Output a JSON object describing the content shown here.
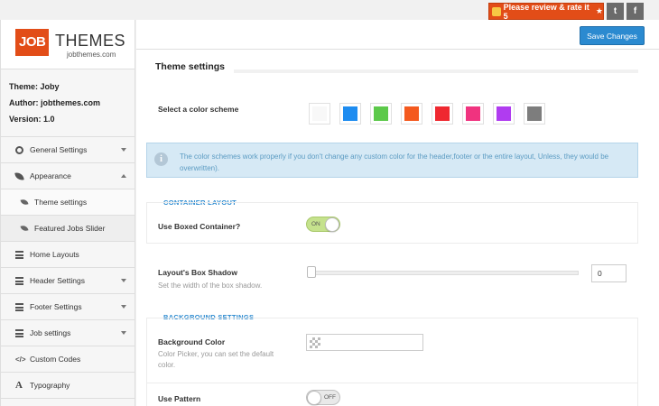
{
  "topbar": {
    "review_label": "Please review & rate it 5",
    "star_glyph": "★",
    "twitter_glyph": "t",
    "facebook_glyph": "f"
  },
  "logo": {
    "job": "JOB",
    "themes": "THEMES",
    "domain": "jobthemes.com"
  },
  "theme_info": {
    "theme": "Theme: Joby",
    "author": "Author: jobthemes.com",
    "version": "Version: 1.0"
  },
  "sidebar": {
    "items": [
      {
        "label": "General Settings",
        "icon": "gear-icon"
      },
      {
        "label": "Appearance",
        "icon": "leaf-icon"
      },
      {
        "label": "Theme settings",
        "icon": "leaf-icon"
      },
      {
        "label": "Featured Jobs Slider",
        "icon": "leaf-icon"
      },
      {
        "label": "Home Layouts",
        "icon": "list-icon"
      },
      {
        "label": "Header Settings",
        "icon": "list-icon"
      },
      {
        "label": "Footer Settings",
        "icon": "list-icon"
      },
      {
        "label": "Job settings",
        "icon": "list-icon"
      },
      {
        "label": "Custom Codes",
        "icon": "code-icon"
      },
      {
        "label": "Typography",
        "icon": "typography-icon"
      }
    ]
  },
  "header": {
    "save_label": "Save Changes"
  },
  "main": {
    "section_title": "Theme settings",
    "color_scheme_label": "Select a color scheme",
    "swatches": [
      "#f8f8f8",
      "#1e8cf0",
      "#5cc94a",
      "#f4591e",
      "#ef2830",
      "#f0337f",
      "#b03cf0",
      "#7d7d7d"
    ],
    "info_icon": "i",
    "info_text": "The color schemes work properly if you don't change any custom color for the header,footer or the entire layout, Unless, they would be overwritten).",
    "container_layout": {
      "title": "CONTAINER LAYOUT",
      "boxed_label": "Use Boxed Container?",
      "boxed_toggle": "ON"
    },
    "box_shadow": {
      "label": "Layout's Box Shadow",
      "desc": "Set the width of the box shadow.",
      "value": "0",
      "level": 0
    },
    "background_settings": {
      "title": "BACKGROUND SETTINGS",
      "bg_color_label": "Background Color",
      "bg_color_desc": "Color Picker, you can set the default color.",
      "pattern_label": "Use Pattern",
      "pattern_toggle": "OFF"
    }
  },
  "colors": {
    "accent": "#2b8ad0",
    "brand": "#e24d18"
  }
}
